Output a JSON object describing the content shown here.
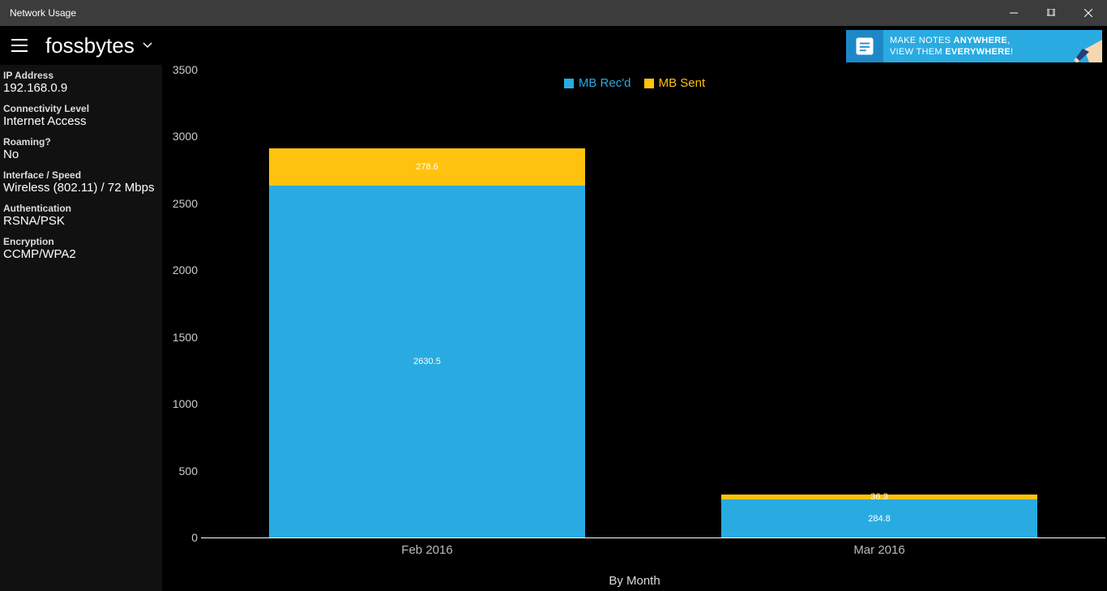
{
  "window": {
    "title": "Network Usage"
  },
  "header": {
    "brand": "fossbytes"
  },
  "ad": {
    "line1_prefix": "MAKE NOTES ",
    "line1_bold": "ANYWHERE",
    "line1_suffix": ",",
    "line2_prefix": "VIEW THEM ",
    "line2_bold": "EVERYWHERE",
    "line2_suffix": "!"
  },
  "sidebar": {
    "ip_label": "IP Address",
    "ip_value": "192.168.0.9",
    "conn_label": "Connectivity Level",
    "conn_value": "Internet Access",
    "roam_label": "Roaming?",
    "roam_value": "No",
    "iface_label": "Interface / Speed",
    "iface_value": "Wireless (802.11) / 72 Mbps",
    "auth_label": "Authentication",
    "auth_value": "RSNA/PSK",
    "enc_label": "Encryption",
    "enc_value": "CCMP/WPA2"
  },
  "legend": {
    "recd": "MB Rec'd",
    "sent": "MB Sent"
  },
  "chart_data": {
    "type": "bar",
    "stacked": true,
    "categories": [
      "Feb 2016",
      "Mar 2016"
    ],
    "series": [
      {
        "name": "MB Rec'd",
        "color": "#29abe2",
        "values": [
          2630.5,
          284.8
        ]
      },
      {
        "name": "MB Sent",
        "color": "#ffc20e",
        "values": [
          278.6,
          36.3
        ]
      }
    ],
    "ylim": [
      0,
      3500
    ],
    "yticks": [
      0,
      500,
      1000,
      1500,
      2000,
      2500,
      3000,
      3500
    ],
    "xlabel": "By Month",
    "ylabel": ""
  },
  "colors": {
    "recd": "#29abe2",
    "sent": "#ffc20e"
  }
}
